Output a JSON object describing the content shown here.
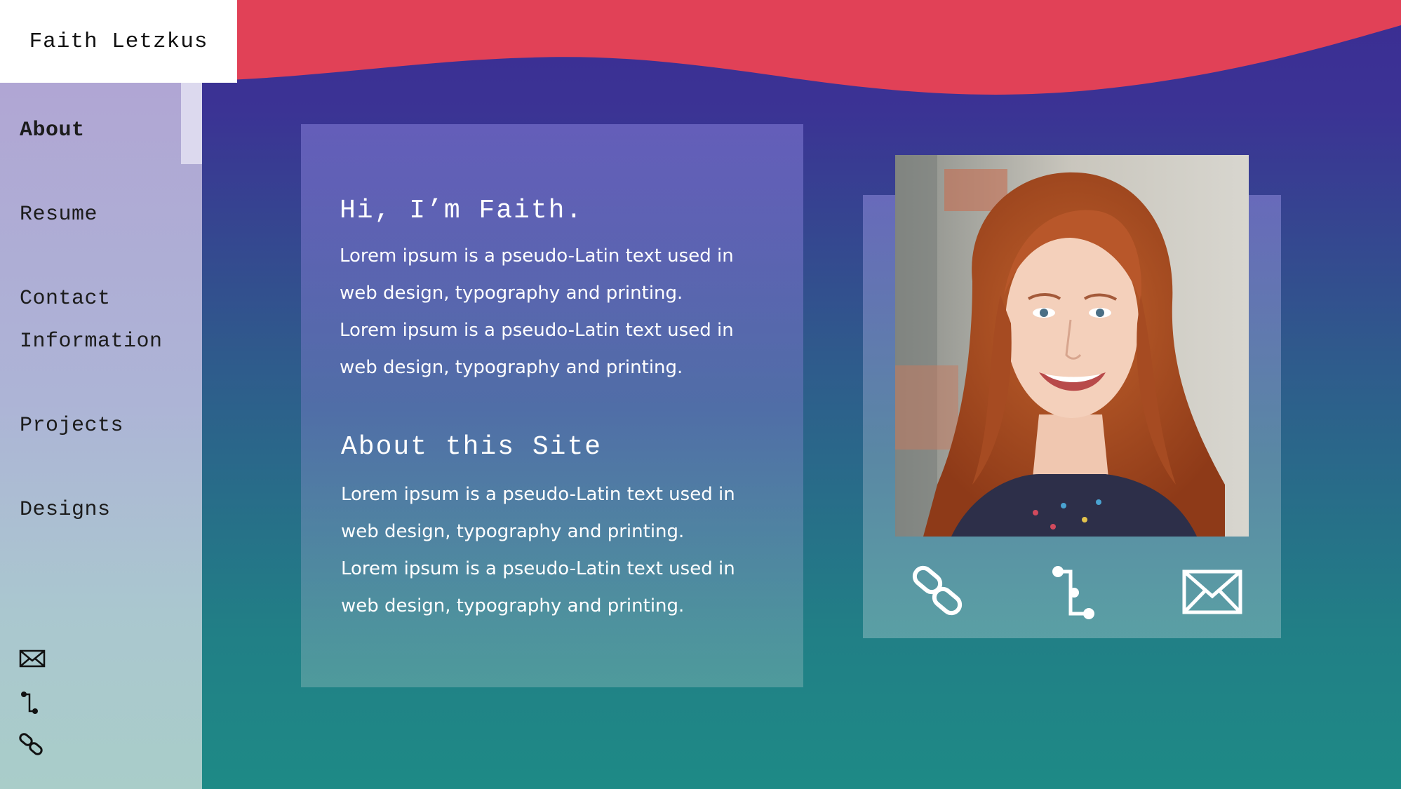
{
  "brand": {
    "name": "Faith Letzkus"
  },
  "nav": {
    "items": [
      {
        "label": "About",
        "active": true
      },
      {
        "label": "Resume",
        "active": false
      },
      {
        "label": "Contact Information",
        "active": false
      },
      {
        "label": "Projects",
        "active": false
      },
      {
        "label": "Designs",
        "active": false
      }
    ]
  },
  "sidebar_icons": [
    "mail-icon",
    "git-branch-icon",
    "link-icon"
  ],
  "intro": {
    "heading": "Hi, I’m Faith.",
    "body_lines": [
      "Lorem ipsum is a pseudo-Latin text used in",
      "web design, typography and printing.",
      "Lorem ipsum is a pseudo-Latin text used in",
      "web design, typography and printing."
    ]
  },
  "about_site": {
    "heading": "About this Site",
    "body_lines": [
      "Lorem ipsum is a pseudo-Latin text used in",
      "web design, typography and printing.",
      "Lorem ipsum is a pseudo-Latin text used in",
      "web design, typography and printing."
    ]
  },
  "card_icons": [
    "link-icon",
    "git-branch-icon",
    "mail-icon"
  ],
  "colors": {
    "header_wave": "#e14157",
    "background_top": "#3b2d93",
    "background_bottom": "#1e8a86",
    "brand_bg": "#ffffff"
  }
}
